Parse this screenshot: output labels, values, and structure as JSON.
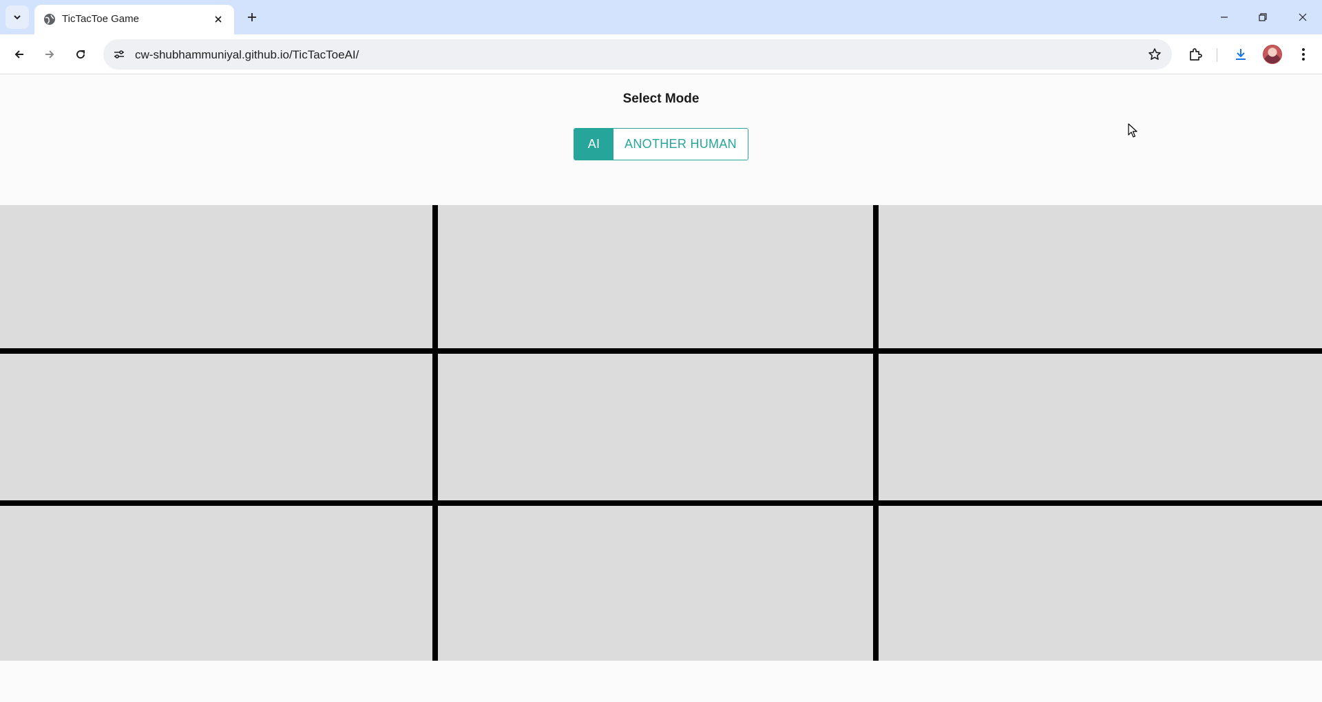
{
  "browser": {
    "tab_title": "TicTacToe Game",
    "url": "cw-shubhammuniyal.github.io/TicTacToeAI/"
  },
  "page": {
    "mode_title": "Select Mode",
    "modes": [
      {
        "label": "AI",
        "selected": true
      },
      {
        "label": "ANOTHER HUMAN",
        "selected": false
      }
    ],
    "accent_color": "#26a69a",
    "board": {
      "rows": 3,
      "cols": 3,
      "cells": [
        "",
        "",
        "",
        "",
        "",
        "",
        "",
        "",
        ""
      ]
    }
  }
}
